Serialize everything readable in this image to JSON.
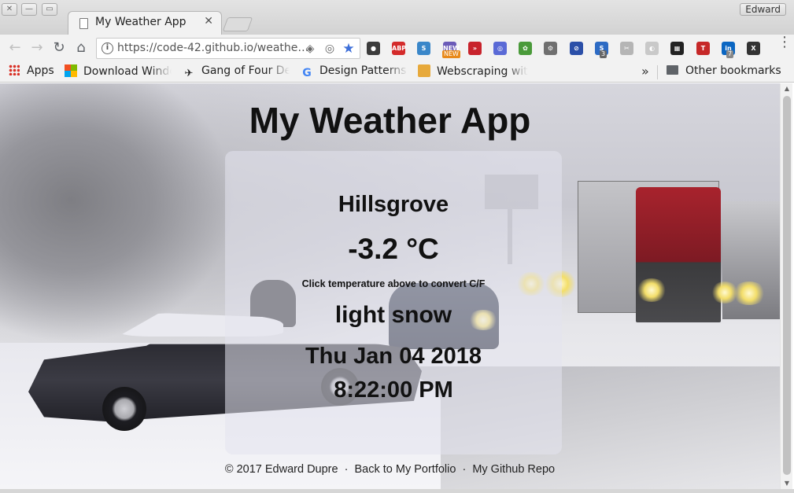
{
  "window": {
    "close_glyph": "✕",
    "minimize_glyph": "—",
    "maximize_glyph": "▭",
    "profile_name": "Edward"
  },
  "tab": {
    "title": "My Weather App",
    "close_glyph": "✕"
  },
  "toolbar": {
    "back_glyph": "←",
    "forward_glyph": "→",
    "reload_glyph": "↻",
    "home_glyph": "⌂",
    "url": "https://code-42.github.io/weathe…",
    "info_glyph": "i",
    "bookmark_star_glyph": "★",
    "menu_glyph": "⋮",
    "extensions": [
      {
        "name": "extension-dark-icon",
        "color": "#3c3c3c",
        "label": "●"
      },
      {
        "name": "adblock-plus-icon",
        "color": "#d42b2b",
        "label": "ABP"
      },
      {
        "name": "extension-s-icon",
        "color": "#3a87c9",
        "label": "S"
      },
      {
        "name": "extension-new-icon",
        "color": "#6b5bb8",
        "label": "NEW"
      },
      {
        "name": "extension-red-forward-icon",
        "color": "#c8232c",
        "label": "»"
      },
      {
        "name": "extension-blue-circle-icon",
        "color": "#5a6ad6",
        "label": "◎"
      },
      {
        "name": "extension-colorwheel-icon",
        "color": "#4a9a3a",
        "label": "✿"
      },
      {
        "name": "extension-gear-icon",
        "color": "#707070",
        "label": "⚙"
      },
      {
        "name": "extension-block-icon",
        "color": "#2b4fa8",
        "label": "⊘"
      },
      {
        "name": "extension-s-badge-icon",
        "color": "#2d6bc4",
        "label": "S"
      },
      {
        "name": "scissors-icon",
        "color": "#b5b5b5",
        "label": "✂"
      },
      {
        "name": "extension-grey-icon",
        "color": "#c9c9c9",
        "label": "◐"
      },
      {
        "name": "extension-grid-icon",
        "color": "#222222",
        "label": "▦"
      },
      {
        "name": "extension-t-icon",
        "color": "#c62828",
        "label": "T"
      },
      {
        "name": "linkedin-icon",
        "color": "#0a66c2",
        "label": "in"
      },
      {
        "name": "extension-x-icon",
        "color": "#333333",
        "label": "X"
      }
    ],
    "badge_s": "3",
    "badge_in": "7",
    "badge_new": "NEW"
  },
  "bookmarks": {
    "apps": "Apps",
    "items": [
      {
        "label": "Download Windo",
        "icon": "windows-logo-icon"
      },
      {
        "label": "Gang of Four De",
        "icon": "gang-of-four-icon"
      },
      {
        "label": "Design Patterns",
        "icon": "google-icon"
      },
      {
        "label": "Webscraping wit",
        "icon": "webscraping-icon"
      }
    ],
    "overflow_glyph": "»",
    "other": "Other bookmarks"
  },
  "app": {
    "title": "My Weather App",
    "city": "Hillsgrove",
    "temperature": "-3.2 °C",
    "convert_hint": "Click temperature above to convert C/F",
    "condition": "light snow",
    "date": "Thu Jan 04 2018",
    "time": "8:22:00 PM"
  },
  "footer": {
    "copyright": "© 2017 Edward Dupre",
    "portfolio_link": "Back to My Portfolio",
    "github_link": "My Github Repo",
    "separator": "·"
  },
  "scrollbar": {
    "up_glyph": "▲",
    "down_glyph": "▼"
  }
}
